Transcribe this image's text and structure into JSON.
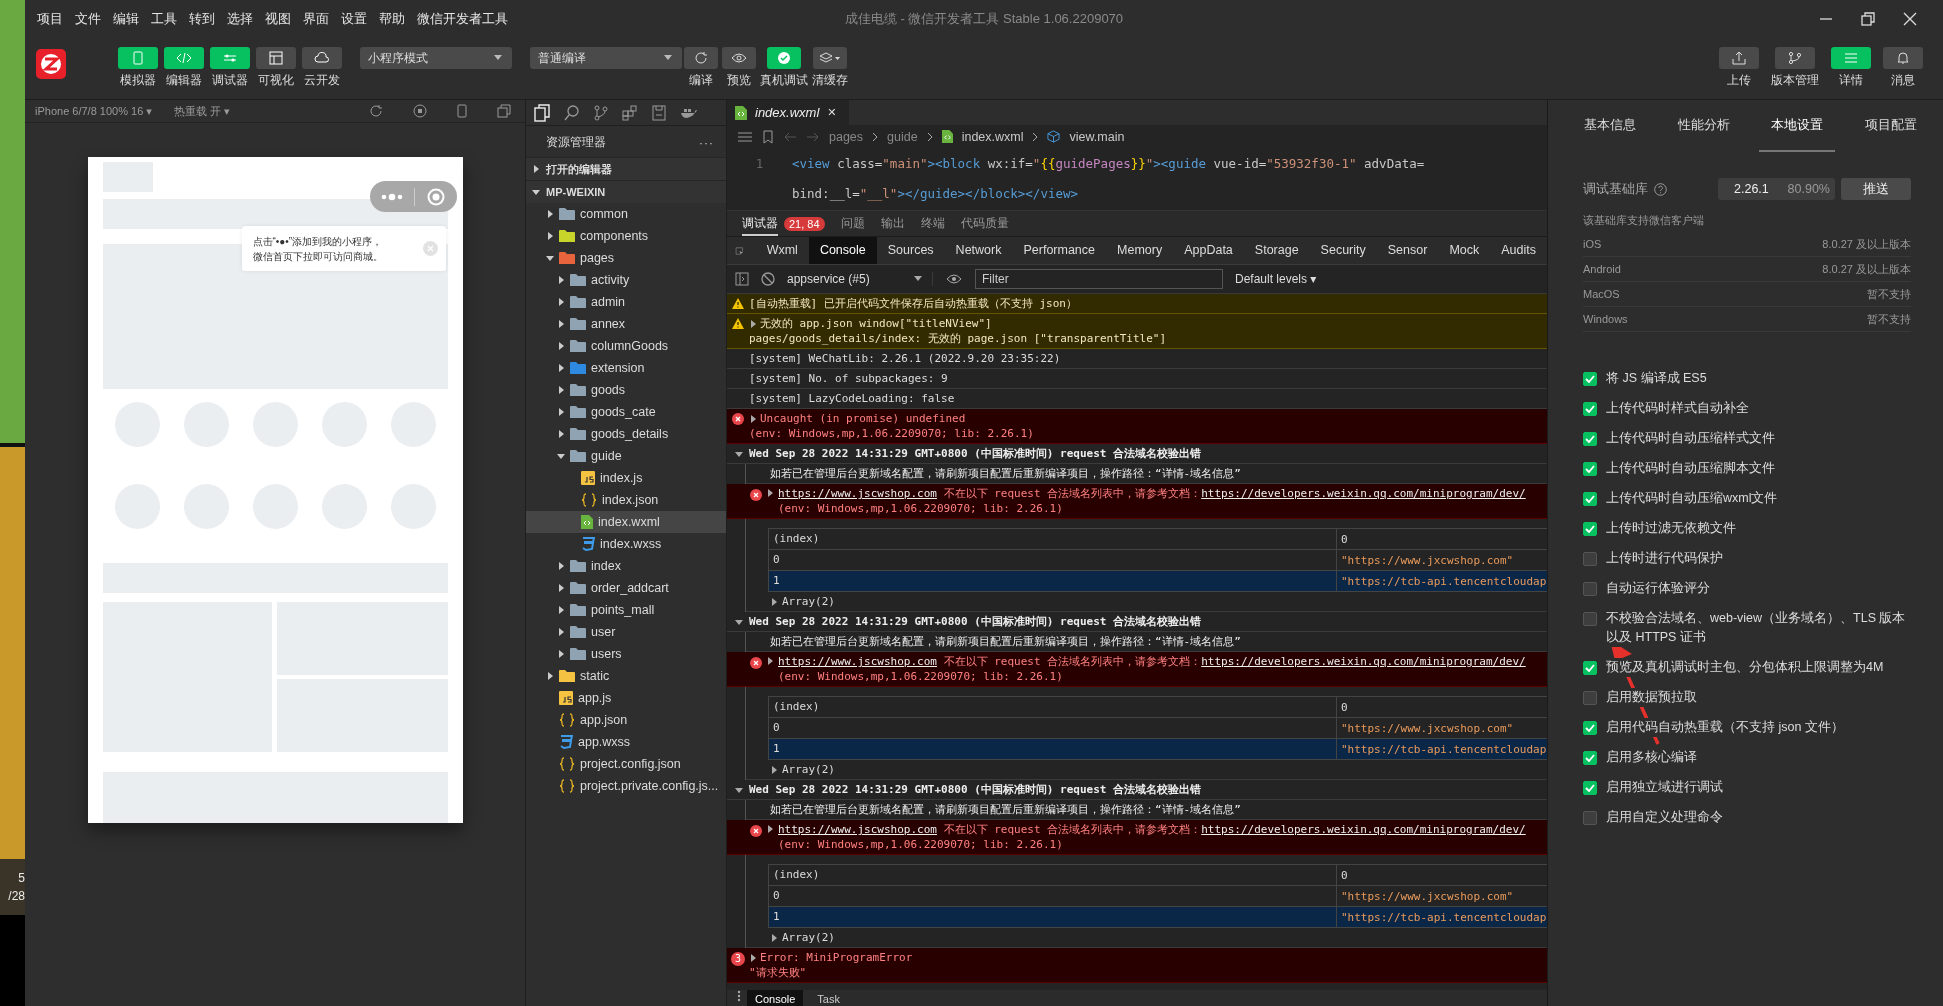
{
  "background_window": {
    "fragments": [
      "5",
      "/28"
    ]
  },
  "menu": [
    "项目",
    "文件",
    "编辑",
    "工具",
    "转到",
    "选择",
    "视图",
    "界面",
    "设置",
    "帮助",
    "微信开发者工具"
  ],
  "window": {
    "title": "成佳电缆 - 微信开发者工具 Stable 1.06.2209070"
  },
  "toolbar": {
    "view_buttons": [
      {
        "label": "模拟器",
        "selected": true
      },
      {
        "label": "编辑器",
        "selected": true
      },
      {
        "label": "调试器",
        "selected": true
      },
      {
        "label": "可视化",
        "selected": false
      },
      {
        "label": "云开发",
        "selected": false
      }
    ],
    "mode_select": "小程序模式",
    "compile_select": "普通编译",
    "actions": [
      {
        "label": "编译",
        "selected": false
      },
      {
        "label": "预览",
        "selected": false
      },
      {
        "label": "真机调试",
        "selected": true
      },
      {
        "label": "清缓存",
        "selected": false
      }
    ],
    "right_actions": [
      {
        "label": "上传",
        "selected": false
      },
      {
        "label": "版本管理",
        "selected": false
      },
      {
        "label": "详情",
        "selected": true
      },
      {
        "label": "消息",
        "selected": false
      }
    ]
  },
  "simulator": {
    "device": "iPhone 6/7/8 100% 16 ▾",
    "hot_reload": "热重载 开 ▾",
    "tooltip": [
      "点击“•●•”添加到我的小程序，",
      "微信首页下拉即可访问商城。"
    ]
  },
  "explorer": {
    "title": "资源管理器",
    "more": "···",
    "sections": [
      {
        "label": "打开的编辑器",
        "expanded": false
      },
      {
        "label": "MP-WEIXIN",
        "expanded": true
      }
    ],
    "tree": [
      {
        "name": "common",
        "kind": "folder",
        "expanded": false,
        "selected": false
      },
      {
        "name": "components",
        "kind": "components",
        "expanded": false,
        "selected": false
      },
      {
        "name": "pages",
        "kind": "pages",
        "expanded": true,
        "selected": false,
        "children": [
          {
            "name": "activity",
            "kind": "folder",
            "expanded": false,
            "selected": false
          },
          {
            "name": "admin",
            "kind": "folder",
            "expanded": false,
            "selected": false
          },
          {
            "name": "annex",
            "kind": "folder",
            "expanded": false,
            "selected": false
          },
          {
            "name": "columnGoods",
            "kind": "folder",
            "expanded": false,
            "selected": false
          },
          {
            "name": "extension",
            "kind": "extension",
            "expanded": false,
            "selected": false
          },
          {
            "name": "goods",
            "kind": "folder",
            "expanded": false,
            "selected": false
          },
          {
            "name": "goods_cate",
            "kind": "folder",
            "expanded": false,
            "selected": false
          },
          {
            "name": "goods_details",
            "kind": "folder",
            "expanded": false,
            "selected": false
          },
          {
            "name": "guide",
            "kind": "folder",
            "expanded": true,
            "selected": false,
            "children": [
              {
                "name": "index.js",
                "kind": "js",
                "selected": false
              },
              {
                "name": "index.json",
                "kind": "json",
                "selected": false
              },
              {
                "name": "index.wxml",
                "kind": "wxml",
                "selected": true
              },
              {
                "name": "index.wxss",
                "kind": "wxss",
                "selected": false
              }
            ]
          },
          {
            "name": "index",
            "kind": "folder",
            "expanded": false,
            "selected": false
          },
          {
            "name": "order_addcart",
            "kind": "folder",
            "expanded": false,
            "selected": false
          },
          {
            "name": "points_mall",
            "kind": "folder",
            "expanded": false,
            "selected": false
          },
          {
            "name": "user",
            "kind": "folder",
            "expanded": false,
            "selected": false
          },
          {
            "name": "users",
            "kind": "folder",
            "expanded": false,
            "selected": false
          }
        ]
      },
      {
        "name": "static",
        "kind": "static",
        "expanded": false,
        "selected": false
      },
      {
        "name": "app.js",
        "kind": "js",
        "selected": false
      },
      {
        "name": "app.json",
        "kind": "json",
        "selected": false
      },
      {
        "name": "app.wxss",
        "kind": "wxss",
        "selected": false
      },
      {
        "name": "project.config.json",
        "kind": "json",
        "selected": false
      },
      {
        "name": "project.private.config.js...",
        "kind": "json",
        "selected": false
      }
    ]
  },
  "editor": {
    "tab": "index.wxml",
    "close": "✕",
    "breadcrumb": [
      "pages",
      "guide",
      "index.wxml",
      "view.main"
    ],
    "lines": [
      {
        "number": "1",
        "tokens": [
          {
            "kind": "tag",
            "t": "<view"
          },
          {
            "kind": "attr",
            "t": " class"
          },
          {
            "kind": "punct",
            "t": "="
          },
          {
            "kind": "str",
            "t": "\"main\""
          },
          {
            "kind": "tag",
            "t": "><block"
          },
          {
            "kind": "attr",
            "t": " wx:if"
          },
          {
            "kind": "punct",
            "t": "="
          },
          {
            "kind": "str",
            "t": "\""
          },
          {
            "kind": "brace",
            "t": "{{"
          },
          {
            "kind": "var",
            "t": "guidePages"
          },
          {
            "kind": "brace",
            "t": "}}"
          },
          {
            "kind": "str",
            "t": "\""
          },
          {
            "kind": "tag",
            "t": "><guide"
          },
          {
            "kind": "attr",
            "t": " vue-id"
          },
          {
            "kind": "punct",
            "t": "="
          },
          {
            "kind": "str",
            "t": "\"53932f30-1\""
          },
          {
            "kind": "attr",
            "t": " advData="
          }
        ]
      },
      {
        "tokens": [
          {
            "kind": "attr",
            "t": "bind:__l"
          },
          {
            "kind": "punct",
            "t": "="
          },
          {
            "kind": "str",
            "t": "\"__l\""
          },
          {
            "kind": "tag",
            "t": "></guide></block></view>"
          }
        ]
      }
    ]
  },
  "debugger": {
    "tabs": [
      {
        "label": "调试器",
        "badge": "21, 84",
        "selected": true
      },
      {
        "label": "问题",
        "selected": false
      },
      {
        "label": "输出",
        "selected": false
      },
      {
        "label": "终端",
        "selected": false
      },
      {
        "label": "代码质量",
        "selected": false
      }
    ],
    "devtools_tabs": [
      {
        "label": "Wxml",
        "selected": false
      },
      {
        "label": "Console",
        "selected": true
      },
      {
        "label": "Sources",
        "selected": false
      },
      {
        "label": "Network",
        "selected": false
      },
      {
        "label": "Performance",
        "selected": false
      },
      {
        "label": "Memory",
        "selected": false
      },
      {
        "label": "AppData",
        "selected": false
      },
      {
        "label": "Storage",
        "selected": false
      },
      {
        "label": "Security",
        "selected": false
      },
      {
        "label": "Sensor",
        "selected": false
      },
      {
        "label": "Mock",
        "selected": false
      },
      {
        "label": "Audits",
        "selected": false
      }
    ],
    "context": "appservice (#5)",
    "filter_placeholder": "Filter",
    "levels": "Default levels ▾"
  },
  "console": {
    "entries": [
      {
        "kind": "warn",
        "lines": [
          "[自动热重载] 已开启代码文件保存后自动热重载（不支持 json）"
        ]
      },
      {
        "kind": "warn",
        "expanded": false,
        "lines": [
          "无效的 app.json window[\"titleNView\"]",
          "pages/goods_details/index: 无效的 page.json [\"transparentTitle\"]"
        ]
      },
      {
        "kind": "info",
        "lines": [
          "[system] WeChatLib: 2.26.1 (2022.9.20 23:35:22)"
        ]
      },
      {
        "kind": "info",
        "lines": [
          "[system] No. of subpackages: 9"
        ]
      },
      {
        "kind": "info",
        "lines": [
          "[system] LazyCodeLoading: false"
        ]
      },
      {
        "kind": "error",
        "expanded": false,
        "lines": [
          "Uncaught (in promise) undefined",
          "(env: Windows,mp,1.06.2209070; lib: 2.26.1)"
        ]
      },
      {
        "kind": "group",
        "expanded": true,
        "title": "Wed Sep 28 2022 14:31:29 GMT+0800 (中国标准时间) request 合法域名校验出错",
        "note": "如若已在管理后台更新域名配置，请刷新项目配置后重新编译项目，操作路径：“详情-域名信息”",
        "error": {
          "expanded": false,
          "link": "https://www.jscwshop.com",
          "text": "不在以下 request 合法域名列表中，请参考文档：",
          "doc": "https://developers.weixin.qq.com/miniprogram/dev/",
          "env": "(env: Windows,mp,1.06.2209070; lib: 2.26.1)"
        },
        "table": {
          "columns": [
            "(index)",
            "0"
          ],
          "rows": [
            [
              "0",
              "\"https://www.jxcwshop.com\""
            ],
            [
              "1",
              "\"https://tcb-api.tencentcloudap"
            ]
          ]
        },
        "array": {
          "label": "Array(2)",
          "expanded": false
        }
      },
      {
        "kind": "group",
        "expanded": true,
        "title": "Wed Sep 28 2022 14:31:29 GMT+0800 (中国标准时间) request 合法域名校验出错",
        "note": "如若已在管理后台更新域名配置，请刷新项目配置后重新编译项目，操作路径：“详情-域名信息”",
        "error": {
          "expanded": false,
          "link": "https://www.jscwshop.com",
          "text": "不在以下 request 合法域名列表中，请参考文档：",
          "doc": "https://developers.weixin.qq.com/miniprogram/dev/",
          "env": "(env: Windows,mp,1.06.2209070; lib: 2.26.1)"
        },
        "table": {
          "columns": [
            "(index)",
            "0"
          ],
          "rows": [
            [
              "0",
              "\"https://www.jxcwshop.com\""
            ],
            [
              "1",
              "\"https://tcb-api.tencentcloudap"
            ]
          ]
        },
        "array": {
          "label": "Array(2)",
          "expanded": false
        }
      },
      {
        "kind": "group",
        "expanded": true,
        "title": "Wed Sep 28 2022 14:31:29 GMT+0800 (中国标准时间) request 合法域名校验出错",
        "note": "如若已在管理后台更新域名配置，请刷新项目配置后重新编译项目，操作路径：“详情-域名信息”",
        "error": {
          "expanded": false,
          "link": "https://www.jscwshop.com",
          "text": "不在以下 request 合法域名列表中，请参考文档：",
          "doc": "https://developers.weixin.qq.com/miniprogram/dev/",
          "env": "(env: Windows,mp,1.06.2209070; lib: 2.26.1)"
        },
        "table": {
          "columns": [
            "(index)",
            "0"
          ],
          "rows": [
            [
              "0",
              "\"https://www.jxcwshop.com\""
            ],
            [
              "1",
              "\"https://tcb-api.tencentcloudap"
            ]
          ]
        },
        "array": {
          "label": "Array(2)",
          "expanded": false
        }
      },
      {
        "kind": "error",
        "count": "3",
        "expanded": false,
        "lines": [
          "Error: MiniProgramError",
          "\"请求失败\""
        ]
      }
    ],
    "drawer_tabs": [
      {
        "label": "Console",
        "selected": true
      },
      {
        "label": "Task",
        "selected": false
      }
    ]
  },
  "details": {
    "tabs": [
      {
        "label": "基本信息",
        "selected": false
      },
      {
        "label": "性能分析",
        "selected": false
      },
      {
        "label": "本地设置",
        "selected": true
      },
      {
        "label": "项目配置",
        "selected": false
      }
    ],
    "library_label": "调试基础库",
    "library_version": "2.26.1",
    "library_share": "80.90%",
    "push_button": "推送",
    "support_title": "该基础库支持微信客户端",
    "platforms": [
      {
        "name": "iOS",
        "value": "8.0.27 及以上版本"
      },
      {
        "name": "Android",
        "value": "8.0.27 及以上版本"
      },
      {
        "name": "MacOS",
        "value": "暂不支持"
      },
      {
        "name": "Windows",
        "value": "暂不支持"
      }
    ],
    "options": [
      {
        "label": "将 JS 编译成 ES5",
        "checked": true
      },
      {
        "label": "上传代码时样式自动补全",
        "checked": true
      },
      {
        "label": "上传代码时自动压缩样式文件",
        "checked": true
      },
      {
        "label": "上传代码时自动压缩脚本文件",
        "checked": true
      },
      {
        "label": "上传代码时自动压缩wxml文件",
        "checked": true
      },
      {
        "label": "上传时过滤无依赖文件",
        "checked": true
      },
      {
        "label": "上传时进行代码保护",
        "checked": false
      },
      {
        "label": "自动运行体验评分",
        "checked": false
      },
      {
        "label": "不校验合法域名、web-view（业务域名）、TLS 版本以及 HTTPS 证书",
        "checked": false
      },
      {
        "label": "预览及真机调试时主包、分包体积上限调整为4M",
        "checked": true
      },
      {
        "label": "启用数据预拉取",
        "checked": false
      },
      {
        "label": "启用代码自动热重载（不支持 json 文件）",
        "checked": true
      },
      {
        "label": "启用多核心编译",
        "checked": true
      },
      {
        "label": "启用独立域进行调试",
        "checked": true
      },
      {
        "label": "启用自定义处理命令",
        "checked": false
      }
    ]
  }
}
